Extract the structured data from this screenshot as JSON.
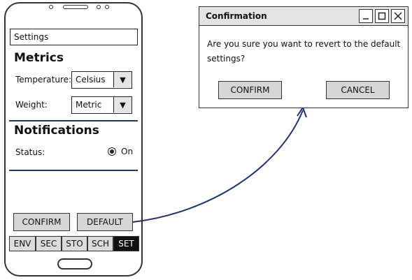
{
  "phone": {
    "title": "Settings",
    "metrics": {
      "heading": "Metrics",
      "temperature_label": "Temperature:",
      "temperature_value": "Celsius",
      "weight_label": "Weight:",
      "weight_value": "Metric"
    },
    "notifications": {
      "heading": "Notifications",
      "status_label": "Status:",
      "status_value": "On"
    },
    "buttons": {
      "confirm": "CONFIRM",
      "default": "DEFAULT"
    },
    "tabs": [
      {
        "label": "ENV",
        "active": false
      },
      {
        "label": "SEC",
        "active": false
      },
      {
        "label": "STO",
        "active": false
      },
      {
        "label": "SCH",
        "active": false
      },
      {
        "label": "SET",
        "active": true
      }
    ]
  },
  "dialog": {
    "title": "Confirmation",
    "message": "Are you sure you want to revert to the default settings?",
    "confirm_label": "CONFIRM",
    "cancel_label": "CANCEL"
  },
  "colors": {
    "accent_line": "#22336e",
    "button_gray": "#d6d6d6",
    "active_tab": "#111111"
  }
}
